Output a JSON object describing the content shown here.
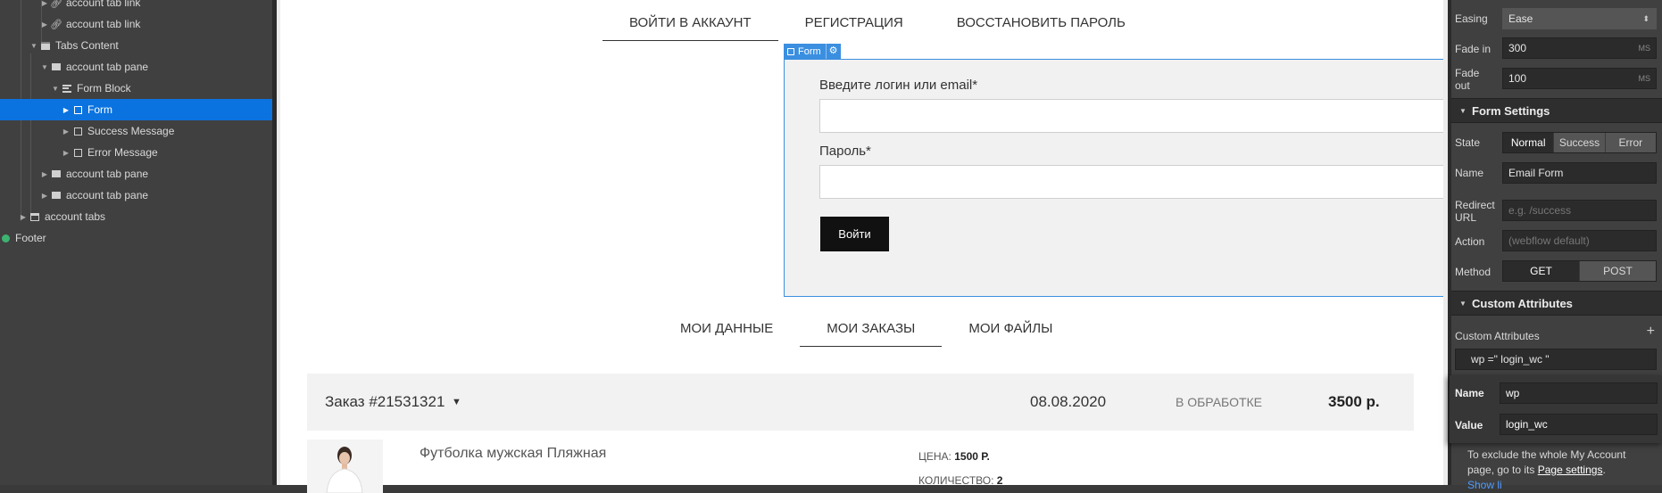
{
  "navigator": {
    "items": [
      {
        "label": "account tab link"
      },
      {
        "label": "account tab link"
      },
      {
        "label": "Tabs Content"
      },
      {
        "label": "account tab pane"
      },
      {
        "label": "Form Block"
      },
      {
        "label": "Form"
      },
      {
        "label": "Success Message"
      },
      {
        "label": "Error Message"
      },
      {
        "label": "account tab pane"
      },
      {
        "label": "account tab pane"
      },
      {
        "label": "account tabs"
      },
      {
        "label": "Footer"
      }
    ]
  },
  "canvas": {
    "top_tabs": [
      "ВОЙТИ В АККАУНТ",
      "РЕГИСТРАЦИЯ",
      "ВОССТАНОВИТЬ ПАРОЛЬ"
    ],
    "form_badge": "Form",
    "form": {
      "login_label": "Введите логин или email*",
      "password_label": "Пароль*",
      "submit_label": "Войти"
    },
    "account_tabs": [
      "МОИ ДАННЫЕ",
      "МОИ ЗАКАЗЫ",
      "МОИ ФАЙЛЫ"
    ],
    "order": {
      "number": "Заказ #21531321",
      "date": "08.08.2020",
      "status": "В ОБРАБОТКЕ",
      "total": "3500 р."
    },
    "product": {
      "name": "Футболка мужская Пляжная",
      "price_label": "ЦЕНА:",
      "price_value": "1500 Р.",
      "qty_label": "КОЛИЧЕСТВО:",
      "qty_value": "2"
    }
  },
  "panel": {
    "easing": {
      "label": "Easing",
      "value": "Ease"
    },
    "fade_in": {
      "label": "Fade in",
      "value": "300",
      "unit": "MS"
    },
    "fade_out": {
      "label1": "Fade",
      "label2": "out",
      "value": "100",
      "unit": "MS"
    },
    "form_settings_title": "Form Settings",
    "state": {
      "label": "State",
      "options": [
        "Normal",
        "Success",
        "Error"
      ],
      "selected": "Normal"
    },
    "name": {
      "label": "Name",
      "value": "Email Form"
    },
    "redirect": {
      "label1": "Redirect",
      "label2": "URL",
      "placeholder": "e.g. /success"
    },
    "action": {
      "label": "Action",
      "placeholder": "(webflow default)"
    },
    "method": {
      "label": "Method",
      "options": [
        "GET",
        "POST"
      ],
      "selected": "POST"
    },
    "custom_attributes_title": "Custom Attributes",
    "custom_attributes_label": "Custom Attributes",
    "attribute_summary": "wp =\" login_wc \"",
    "popup": {
      "name_label": "Name",
      "name_value": "wp",
      "value_label": "Value",
      "value_value": "login_wc"
    },
    "info": {
      "text1": "To exclude the whole My Account page, go to its",
      "link": "Page settings",
      "text2": ".",
      "more": "Show li"
    }
  }
}
